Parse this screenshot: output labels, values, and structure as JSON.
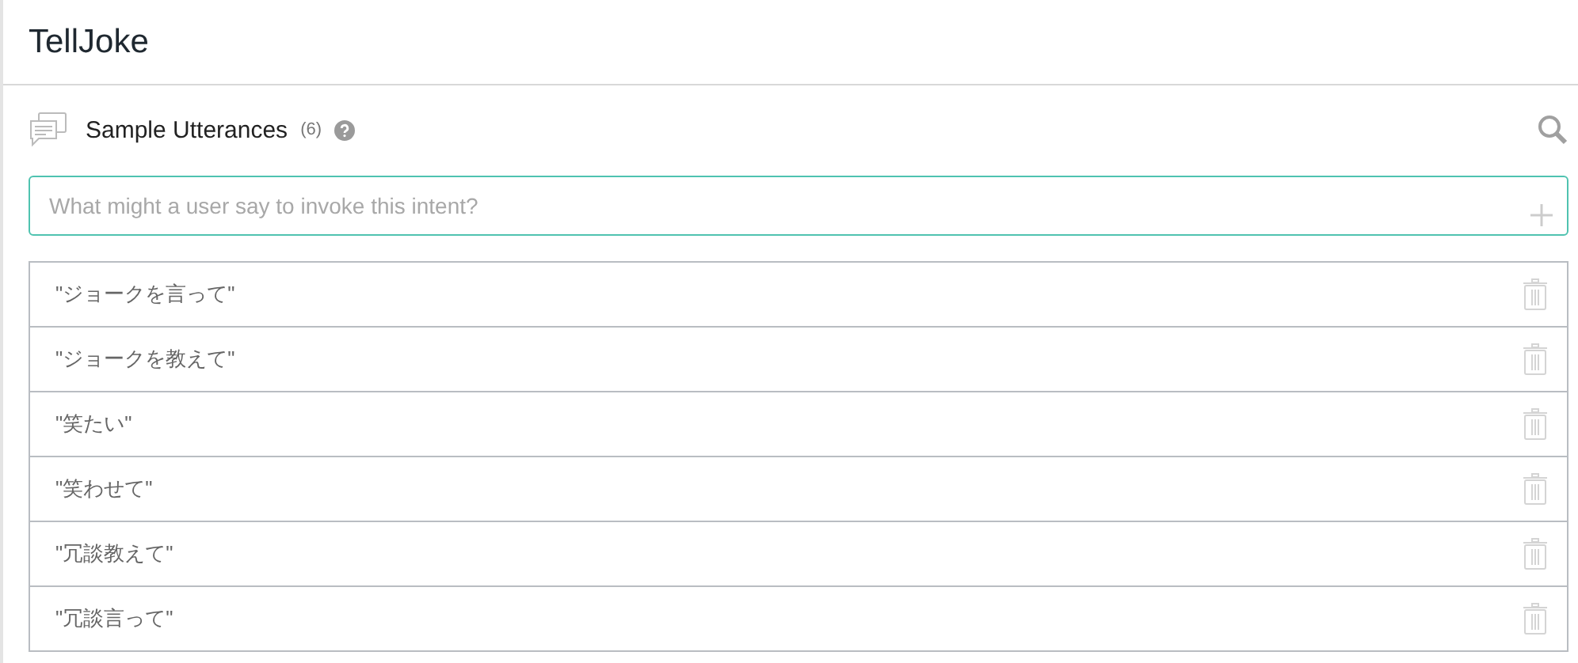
{
  "title": "TellJoke",
  "section": {
    "label": "Sample Utterances",
    "count": "(6)"
  },
  "input": {
    "placeholder": "What might a user say to invoke this intent?"
  },
  "utterances": [
    {
      "text": "\"ジョークを言って\""
    },
    {
      "text": "\"ジョークを教えて\""
    },
    {
      "text": "\"笑たい\""
    },
    {
      "text": "\"笑わせて\""
    },
    {
      "text": "\"冗談教えて\""
    },
    {
      "text": "\"冗談言って\""
    }
  ]
}
